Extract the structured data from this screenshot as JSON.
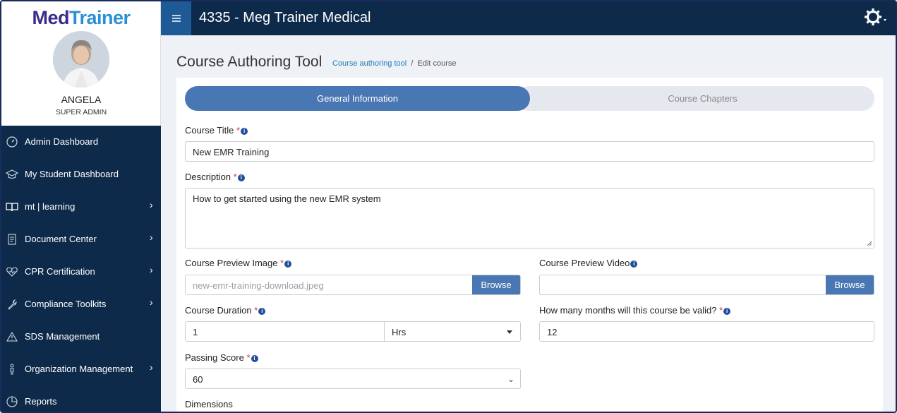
{
  "brand": {
    "logo_part1": "Med",
    "logo_part2": "Trainer"
  },
  "profile": {
    "name": "ANGELA",
    "role": "SUPER ADMIN"
  },
  "sidebar": {
    "items": [
      {
        "label": "Admin Dashboard",
        "icon": "dashboard-gauge-icon",
        "has_submenu": false
      },
      {
        "label": "My Student Dashboard",
        "icon": "graduation-cap-icon",
        "has_submenu": false
      },
      {
        "label": "mt | learning",
        "icon": "open-book-icon",
        "has_submenu": true
      },
      {
        "label": "Document Center",
        "icon": "document-icon",
        "has_submenu": true
      },
      {
        "label": "CPR Certification",
        "icon": "heart-pulse-icon",
        "has_submenu": true
      },
      {
        "label": "Compliance Toolkits",
        "icon": "wrench-icon",
        "has_submenu": true
      },
      {
        "label": "SDS Management",
        "icon": "warning-triangle-icon",
        "has_submenu": false
      },
      {
        "label": "Organization Management",
        "icon": "person-icon",
        "has_submenu": true
      },
      {
        "label": "Reports",
        "icon": "pie-chart-icon",
        "has_submenu": false
      }
    ]
  },
  "header": {
    "title": "4335 - Meg Trainer Medical",
    "menu_icon": "hamburger-icon",
    "settings_icon": "gear-icon"
  },
  "page": {
    "title": "Course Authoring Tool",
    "breadcrumb": {
      "link": "Course authoring tool",
      "separator": "/",
      "current": "Edit course"
    }
  },
  "tabs": [
    {
      "label": "General Information",
      "active": true
    },
    {
      "label": "Course Chapters",
      "active": false
    }
  ],
  "form": {
    "course_title": {
      "label": "Course Title",
      "required": "*",
      "value": "New EMR Training"
    },
    "description": {
      "label": "Description",
      "required": "*",
      "value": "How to get started using the new EMR system"
    },
    "preview_image": {
      "label": "Course Preview Image",
      "required": "*",
      "placeholder": "new-emr-training-download.jpeg",
      "button": "Browse"
    },
    "preview_video": {
      "label": "Course Preview Video",
      "value": "",
      "button": "Browse"
    },
    "duration": {
      "label": "Course Duration",
      "required": "*",
      "value": "1",
      "unit": "Hrs"
    },
    "valid_months": {
      "label": "How many months will this course be valid?",
      "required": "*",
      "value": "12"
    },
    "passing_score": {
      "label": "Passing Score",
      "required": "*",
      "value": "60"
    },
    "dimensions": {
      "label": "Dimensions"
    }
  },
  "colors": {
    "sidebar_bg": "#0e2a4a",
    "accent": "#4877b3",
    "required": "#dd3333",
    "info": "#1e4f9e"
  }
}
